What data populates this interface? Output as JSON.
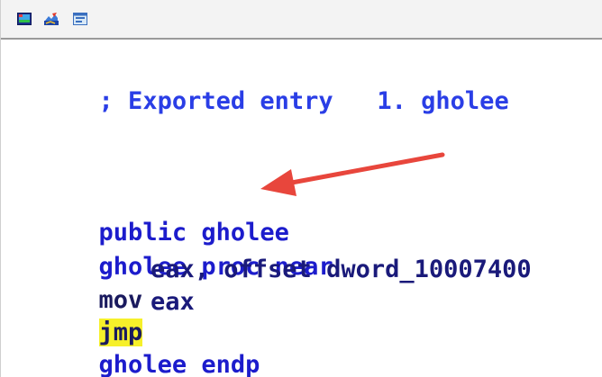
{
  "toolbar": {
    "buttons": [
      {
        "icon": "graph-view-icon"
      },
      {
        "icon": "chart-edit-icon"
      },
      {
        "icon": "structure-view-icon"
      }
    ]
  },
  "code": {
    "comment": "; Exported entry   1. gholee",
    "public_kw": "public",
    "public_name": "gholee",
    "proc_name": "gholee",
    "proc_kw": "proc near",
    "mov_mnemonic": "mov",
    "mov_operand": "eax, offset dword_10007400",
    "jmp_mnemonic": "jmp",
    "jmp_operand": "eax",
    "endp_name": "gholee",
    "endp_kw": "endp"
  },
  "colors": {
    "keyword": "#1c1ccc",
    "comment": "#2a3ee6",
    "highlight": "#f6f02a",
    "arrow": "#e8463c"
  }
}
